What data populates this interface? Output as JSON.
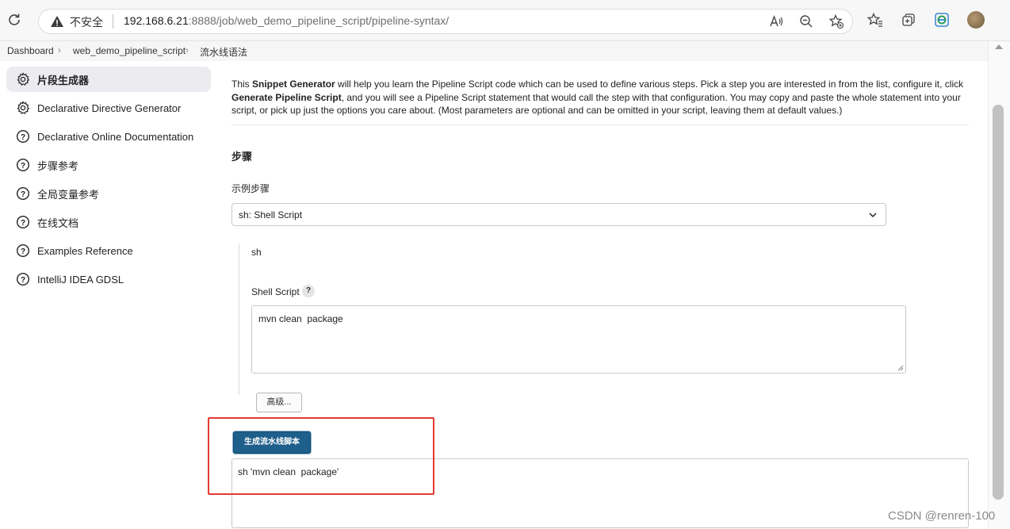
{
  "browser": {
    "insecure_label": "不安全",
    "url_host": "192.168.6.21",
    "url_rest": ":8888/job/web_demo_pipeline_script/pipeline-syntax/"
  },
  "breadcrumb": {
    "items": [
      "Dashboard",
      "web_demo_pipeline_script",
      "流水线语法"
    ]
  },
  "sidebar": {
    "items": [
      {
        "label": "片段生成器",
        "icon": "gear-icon",
        "active": true
      },
      {
        "label": "Declarative Directive Generator",
        "icon": "gear-icon"
      },
      {
        "label": "Declarative Online Documentation",
        "icon": "help-circle-icon"
      },
      {
        "label": "步骤参考",
        "icon": "help-circle-icon"
      },
      {
        "label": "全局变量参考",
        "icon": "help-circle-icon"
      },
      {
        "label": "在线文档",
        "icon": "help-circle-icon"
      },
      {
        "label": "Examples Reference",
        "icon": "help-circle-icon"
      },
      {
        "label": "IntelliJ IDEA GDSL",
        "icon": "help-circle-icon"
      }
    ]
  },
  "main": {
    "intro": {
      "t1": "This ",
      "b1": "Snippet Generator",
      "t2": " will help you learn the Pipeline Script code which can be used to define various steps. Pick a step you are interested in from the list, configure it, click ",
      "b2": "Generate Pipeline Script",
      "t3": ", and you will see a Pipeline Script statement that would call the step with that configuration. You may copy and paste the whole statement into your script, or pick up just the options you care about. (Most parameters are optional and can be omitted in your script, leaving them at default values.)"
    },
    "section_title": "步骤",
    "sample_step_label": "示例步骤",
    "selected_step": "sh: Shell Script",
    "step_name": "sh",
    "shell_script_label": "Shell Script",
    "help_label": "?",
    "shell_script_value": "mvn clean  package",
    "advanced_label": "高级...",
    "generate_label": "生成流水线脚本",
    "output_value": "sh 'mvn clean  package'"
  },
  "watermark": "CSDN @renren-100",
  "colors": {
    "generate_button": "#1f5f8b",
    "highlight_border": "#e53935"
  }
}
